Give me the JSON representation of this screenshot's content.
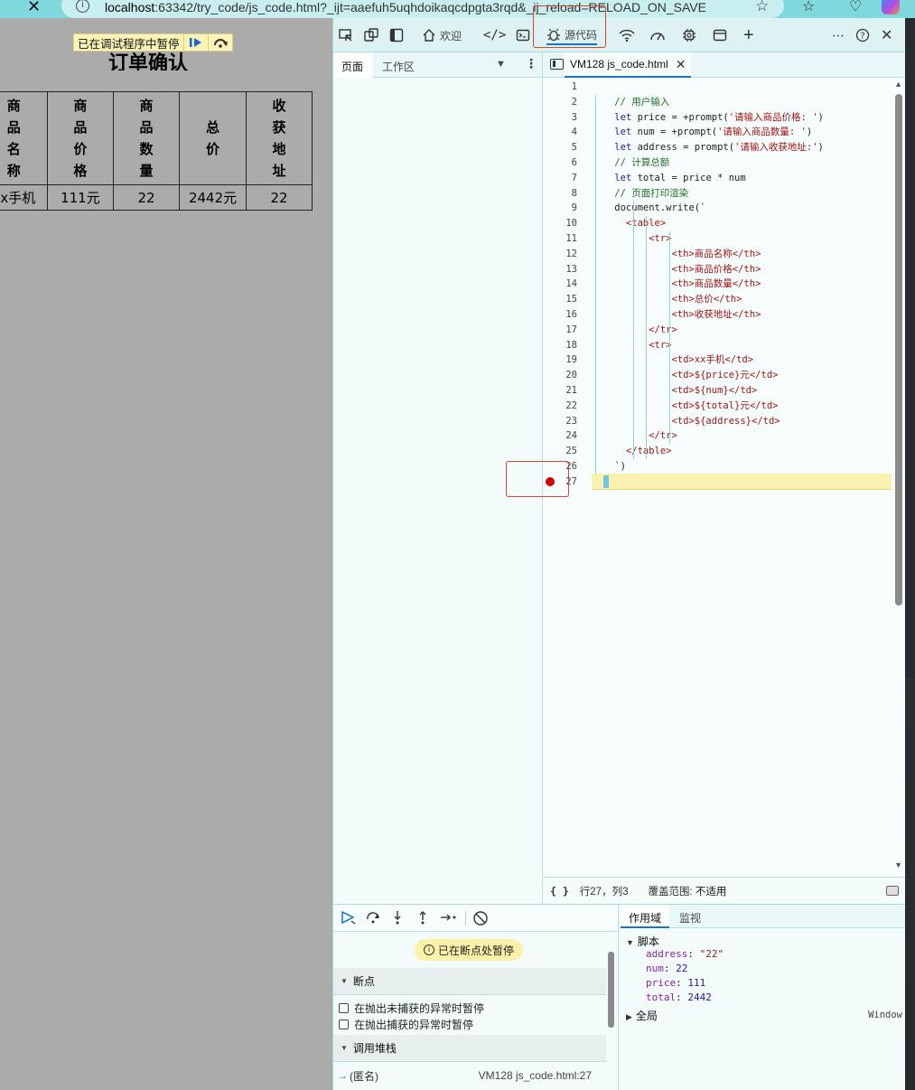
{
  "browser": {
    "url_host": "localhost",
    "url_rest": ":63342/try_code/js_code.html?_ijt=aaefuh5uqhdoikaqcdpgta3rqd&_ij_reload=RELOAD_ON_SAVE"
  },
  "page": {
    "paused_text": "已在调试程序中暂停",
    "title": "订单确认",
    "table": {
      "headers": [
        "商品名称",
        "商品价格",
        "商品数量",
        "总价",
        "收获地址"
      ],
      "row": [
        "xx手机",
        "111元",
        "22",
        "2442元",
        "22"
      ]
    }
  },
  "devtools": {
    "toolbar": {
      "welcome_label": "欢迎",
      "sources_label": "源代码"
    },
    "navigator": {
      "tabs": [
        "页面",
        "工作区"
      ]
    },
    "editor": {
      "file_tab": "VM128 js_code.html",
      "line_count": 27,
      "current_line": 27,
      "breakpoint_line": 27,
      "code_lines": [
        "",
        "    // 用户输入",
        "    let price = +prompt('请输入商品价格: ')",
        "    let num = +prompt('请输入商品数量: ')",
        "    let address = prompt('请输入收获地址:')",
        "    // 计算总额",
        "    let total = price * num",
        "    // 页面打印渲染",
        "    document.write(`",
        "      <table>",
        "          <tr>",
        "              <th>商品名称</th>",
        "              <th>商品价格</th>",
        "              <th>商品数量</th>",
        "              <th>总价</th>",
        "              <th>收获地址</th>",
        "          </tr>",
        "          <tr>",
        "              <td>xx手机</td>",
        "              <td>${price}元</td>",
        "              <td>${num}</td>",
        "              <td>${total}元</td>",
        "              <td>${address}</td>",
        "          </tr>",
        "      </table>",
        "    `)",
        ""
      ],
      "status": {
        "braces": "{ }",
        "position": "行27，列3",
        "coverage_label": "覆盖范围:",
        "coverage_value": "不适用"
      }
    },
    "debugger": {
      "paused_banner": "已在断点处暂停",
      "breakpoints_heading": "断点",
      "pause_uncaught": "在抛出未捕获的异常时暂停",
      "pause_caught": "在抛出捕获的异常时暂停",
      "callstack_heading": "调用堆栈",
      "frame_name": "(匿名)",
      "frame_location": "VM128 js_code.html:27",
      "scope_tabs": [
        "作用域",
        "监视"
      ],
      "script_label": "脚本",
      "vars": [
        {
          "name": "address",
          "value": "\"22\"",
          "kind": "string"
        },
        {
          "name": "num",
          "value": "22",
          "kind": "number"
        },
        {
          "name": "price",
          "value": "111",
          "kind": "number"
        },
        {
          "name": "total",
          "value": "2442",
          "kind": "number"
        }
      ],
      "global_label": "全局",
      "global_value": "Window"
    }
  }
}
